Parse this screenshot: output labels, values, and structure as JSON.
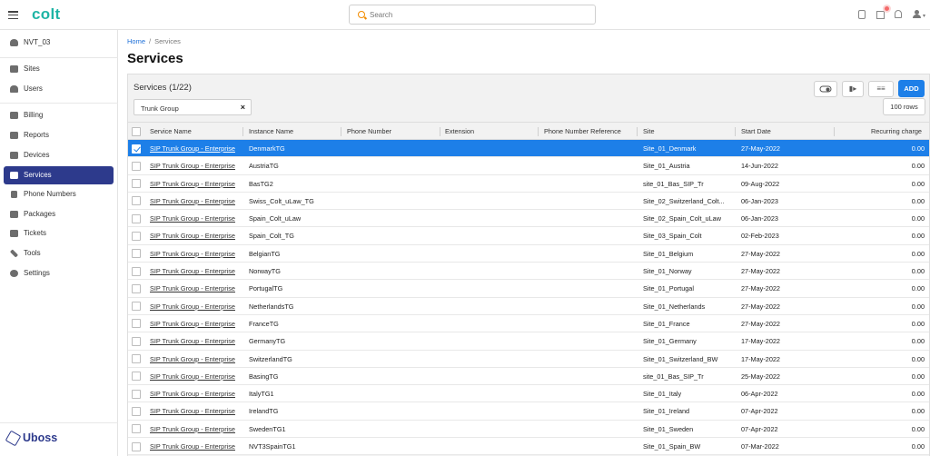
{
  "header": {
    "brand": "colt",
    "search_placeholder": "Search"
  },
  "sidebar": {
    "account": "NVT_03",
    "items": [
      {
        "label": "Sites"
      },
      {
        "label": "Users"
      },
      {
        "label": "Billing"
      },
      {
        "label": "Reports"
      },
      {
        "label": "Devices"
      },
      {
        "label": "Services"
      },
      {
        "label": "Phone Numbers"
      },
      {
        "label": "Packages"
      },
      {
        "label": "Tickets"
      },
      {
        "label": "Tools"
      },
      {
        "label": "Settings"
      }
    ],
    "footer_brand": "Uboss"
  },
  "breadcrumb": {
    "home": "Home",
    "separator": "/",
    "current": "Services"
  },
  "page_title": "Services",
  "panel": {
    "title": "Services (1/22)",
    "add_label": "ADD",
    "filter_value": "Trunk Group",
    "filter_clear": "×",
    "rows_label": "100 rows"
  },
  "table": {
    "columns": [
      "Service Name",
      "Instance Name",
      "Phone Number",
      "Extension",
      "Phone Number Reference",
      "Site",
      "Start Date",
      "Recurring charge"
    ],
    "rows": [
      {
        "service": "SIP Trunk Group - Enterprise",
        "instance": "DenmarkTG",
        "phone": "",
        "ext": "",
        "ref": "",
        "site": "Site_01_Denmark",
        "start": "27-May-2022",
        "charge": "0.00",
        "selected": true
      },
      {
        "service": "SIP Trunk Group - Enterprise",
        "instance": "AustriaTG",
        "phone": "",
        "ext": "",
        "ref": "",
        "site": "Site_01_Austria",
        "start": "14-Jun-2022",
        "charge": "0.00"
      },
      {
        "service": "SIP Trunk Group - Enterprise",
        "instance": "BasTG2",
        "phone": "",
        "ext": "",
        "ref": "",
        "site": "site_01_Bas_SIP_Tr",
        "start": "09-Aug-2022",
        "charge": "0.00"
      },
      {
        "service": "SIP Trunk Group - Enterprise",
        "instance": "Swiss_Colt_uLaw_TG",
        "phone": "",
        "ext": "",
        "ref": "",
        "site": "Site_02_Switzerland_Colt...",
        "start": "06-Jan-2023",
        "charge": "0.00"
      },
      {
        "service": "SIP Trunk Group - Enterprise",
        "instance": "Spain_Colt_uLaw",
        "phone": "",
        "ext": "",
        "ref": "",
        "site": "Site_02_Spain_Colt_uLaw",
        "start": "06-Jan-2023",
        "charge": "0.00"
      },
      {
        "service": "SIP Trunk Group - Enterprise",
        "instance": "Spain_Colt_TG",
        "phone": "",
        "ext": "",
        "ref": "",
        "site": "Site_03_Spain_Colt",
        "start": "02-Feb-2023",
        "charge": "0.00"
      },
      {
        "service": "SIP Trunk Group - Enterprise",
        "instance": "BelgianTG",
        "phone": "",
        "ext": "",
        "ref": "",
        "site": "Site_01_Belgium",
        "start": "27-May-2022",
        "charge": "0.00"
      },
      {
        "service": "SIP Trunk Group - Enterprise",
        "instance": "NorwayTG",
        "phone": "",
        "ext": "",
        "ref": "",
        "site": "Site_01_Norway",
        "start": "27-May-2022",
        "charge": "0.00"
      },
      {
        "service": "SIP Trunk Group - Enterprise",
        "instance": "PortugalTG",
        "phone": "",
        "ext": "",
        "ref": "",
        "site": "Site_01_Portugal",
        "start": "27-May-2022",
        "charge": "0.00"
      },
      {
        "service": "SIP Trunk Group - Enterprise",
        "instance": "NetherlandsTG",
        "phone": "",
        "ext": "",
        "ref": "",
        "site": "Site_01_Netherlands",
        "start": "27-May-2022",
        "charge": "0.00"
      },
      {
        "service": "SIP Trunk Group - Enterprise",
        "instance": "FranceTG",
        "phone": "",
        "ext": "",
        "ref": "",
        "site": "Site_01_France",
        "start": "27-May-2022",
        "charge": "0.00"
      },
      {
        "service": "SIP Trunk Group - Enterprise",
        "instance": "GermanyTG",
        "phone": "",
        "ext": "",
        "ref": "",
        "site": "Site_01_Germany",
        "start": "17-May-2022",
        "charge": "0.00"
      },
      {
        "service": "SIP Trunk Group - Enterprise",
        "instance": "SwitzerlandTG",
        "phone": "",
        "ext": "",
        "ref": "",
        "site": "Site_01_Switzerland_BW",
        "start": "17-May-2022",
        "charge": "0.00"
      },
      {
        "service": "SIP Trunk Group - Enterprise",
        "instance": "BasingTG",
        "phone": "",
        "ext": "",
        "ref": "",
        "site": "site_01_Bas_SIP_Tr",
        "start": "25-May-2022",
        "charge": "0.00"
      },
      {
        "service": "SIP Trunk Group - Enterprise",
        "instance": "ItalyTG1",
        "phone": "",
        "ext": "",
        "ref": "",
        "site": "Site_01_Italy",
        "start": "06-Apr-2022",
        "charge": "0.00"
      },
      {
        "service": "SIP Trunk Group - Enterprise",
        "instance": "IrelandTG",
        "phone": "",
        "ext": "",
        "ref": "",
        "site": "Site_01_Ireland",
        "start": "07-Apr-2022",
        "charge": "0.00"
      },
      {
        "service": "SIP Trunk Group - Enterprise",
        "instance": "SwedenTG1",
        "phone": "",
        "ext": "",
        "ref": "",
        "site": "Site_01_Sweden",
        "start": "07-Apr-2022",
        "charge": "0.00"
      },
      {
        "service": "SIP Trunk Group - Enterprise",
        "instance": "NVT3SpainTG1",
        "phone": "",
        "ext": "",
        "ref": "",
        "site": "Site_01_Spain_BW",
        "start": "07-Mar-2022",
        "charge": "0.00"
      }
    ]
  },
  "colors": {
    "accent": "#1d7fe8",
    "brand": "#1fb5a5",
    "nav_active": "#2d3a8c",
    "search_icon": "#f28c00"
  }
}
